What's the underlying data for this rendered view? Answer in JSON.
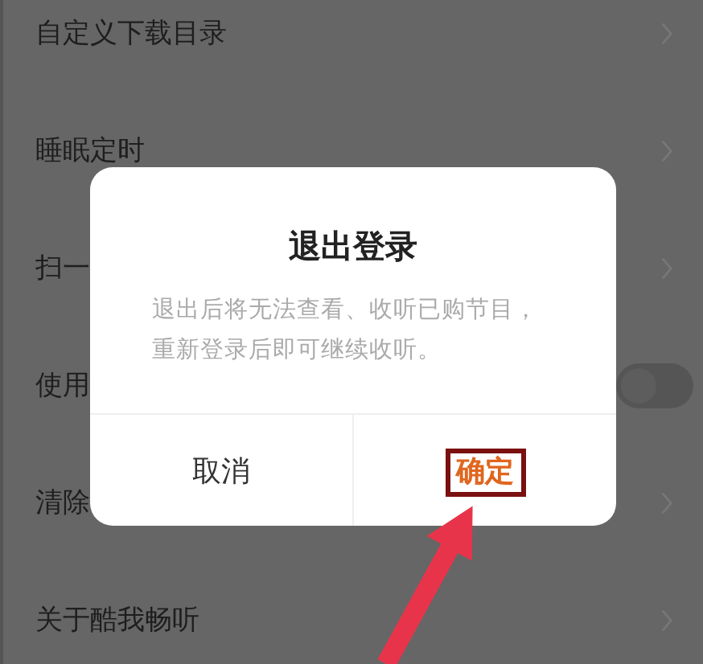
{
  "settings": [
    {
      "label": "自定义下载目录",
      "kind": "link"
    },
    {
      "label": "睡眠定时",
      "kind": "link"
    },
    {
      "label": "扫一",
      "kind": "link"
    },
    {
      "label": "使用",
      "kind": "toggle",
      "on": false
    },
    {
      "label": "清除",
      "kind": "link"
    },
    {
      "label": "关于酷我畅听",
      "kind": "link"
    }
  ],
  "dialog": {
    "title": "退出登录",
    "message": "退出后将无法查看、收听已购节目，重新登录后即可继续收听。",
    "buttons": [
      {
        "label": "取消",
        "kind": "cancel",
        "highlighted": false
      },
      {
        "label": "确定",
        "kind": "confirm",
        "highlighted": true
      }
    ]
  },
  "annotation_arrow": true
}
